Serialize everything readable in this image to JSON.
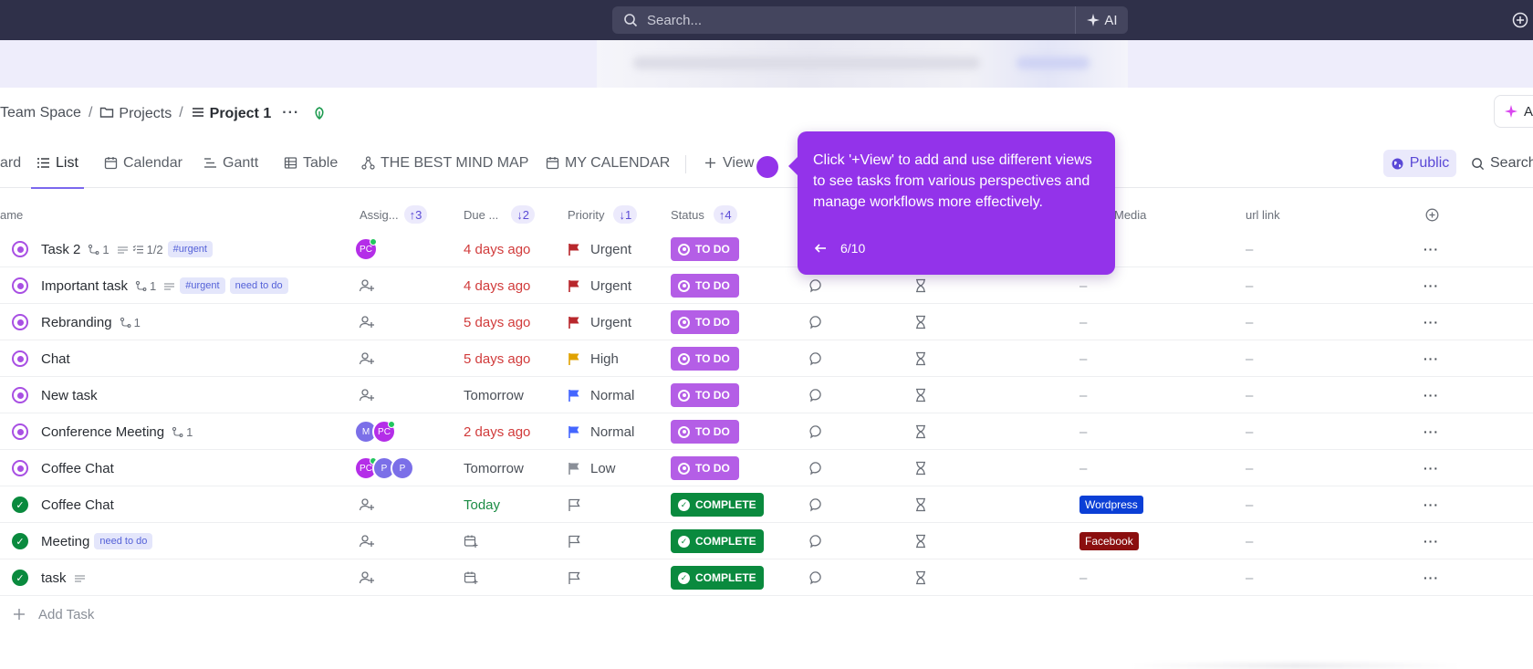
{
  "topbar": {
    "search_placeholder": "Search...",
    "ai_label": "AI"
  },
  "breadcrumb": {
    "space": "Team Space",
    "folder": "Projects",
    "list": "Project 1",
    "more": "···"
  },
  "ask_label": "A",
  "tabs": [
    {
      "label": "ard"
    },
    {
      "label": "List",
      "active": true
    },
    {
      "label": "Calendar"
    },
    {
      "label": "Gantt"
    },
    {
      "label": "Table"
    },
    {
      "label": "THE BEST MIND MAP"
    },
    {
      "label": "MY CALENDAR"
    },
    {
      "label": "View"
    }
  ],
  "public_label": "Public",
  "search_label": "Search",
  "columns": {
    "name": "ame",
    "assignee": "Assig...",
    "assignee_sort": "3",
    "due": "Due ...",
    "due_sort": "2",
    "priority": "Priority",
    "priority_sort": "1",
    "status": "Status",
    "status_sort": "4",
    "media": "Media",
    "url": "url link"
  },
  "rows": [
    {
      "name": "Task 2",
      "subtasks": "1",
      "checklist": "1/2",
      "tags": [
        "#urgent"
      ],
      "due": "4 days ago",
      "priority": "Urgent",
      "status": "TO DO",
      "media": "–",
      "url": "–"
    },
    {
      "name": "Important task",
      "subtasks": "1",
      "tags": [
        "#urgent",
        "need to do"
      ],
      "due": "4 days ago",
      "priority": "Urgent",
      "status": "TO DO",
      "media": "–",
      "url": "–"
    },
    {
      "name": "Rebranding",
      "subtasks": "1",
      "due": "5 days ago",
      "priority": "Urgent",
      "status": "TO DO",
      "media": "–",
      "url": "–"
    },
    {
      "name": "Chat",
      "due": "5 days ago",
      "priority": "High",
      "status": "TO DO",
      "media": "–",
      "url": "–"
    },
    {
      "name": "New task",
      "due": "Tomorrow",
      "priority": "Normal",
      "status": "TO DO",
      "media": "–",
      "url": "–"
    },
    {
      "name": "Conference Meeting",
      "subtasks": "1",
      "due": "2 days ago",
      "priority": "Normal",
      "status": "TO DO",
      "media": "–",
      "url": "–"
    },
    {
      "name": "Coffee Chat",
      "due": "Tomorrow",
      "priority": "Low",
      "status": "TO DO",
      "media": "–",
      "url": "–"
    },
    {
      "name": "Coffee Chat",
      "due": "Today",
      "priority": "",
      "status": "COMPLETE",
      "media": "Wordpress",
      "url": "–"
    },
    {
      "name": "Meeting",
      "tags": [
        "need to do"
      ],
      "due": "",
      "priority": "",
      "status": "COMPLETE",
      "media": "Facebook",
      "url": "–"
    },
    {
      "name": "task",
      "due": "",
      "priority": "",
      "status": "COMPLETE",
      "media": "–",
      "url": "–"
    }
  ],
  "avatars": {
    "pc": "PC",
    "m": "M",
    "p": "P"
  },
  "add_task": "Add Task",
  "tooltip": {
    "message": "Click '+View' to add and use different views to see tasks from various perspectives and manage workflows more effectively.",
    "step": "6/10"
  },
  "colors": {
    "accent": "#7b68ee",
    "todo": "#b45ee6",
    "complete": "#0a8a3e",
    "tooltip": "#9333ea",
    "urgent_flag": "#b8272c",
    "high_flag": "#e0a200",
    "normal_flag": "#4466ff",
    "low_flag": "#8a8f98"
  }
}
